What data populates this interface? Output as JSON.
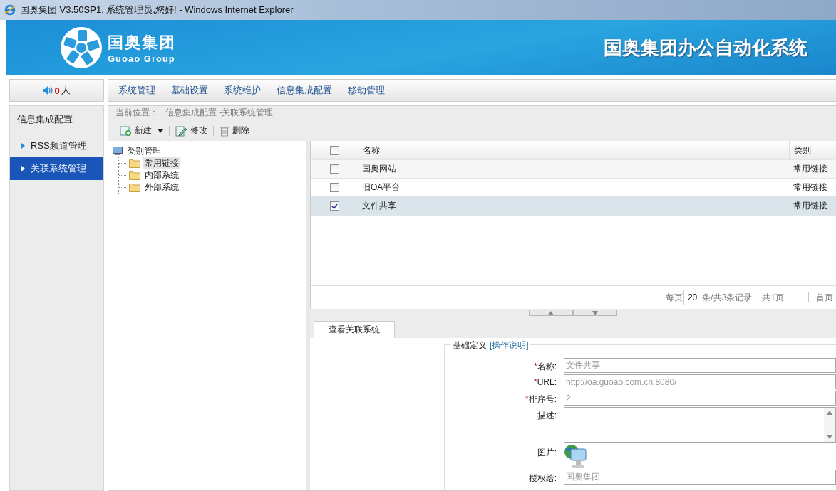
{
  "window": {
    "title": "国奥集团 V3.50SP1, 系统管理员,您好! - Windows Internet Explorer"
  },
  "banner": {
    "logo_cn": "国奥集团",
    "logo_en": "Guoao Group",
    "system_name": "国奥集团办公自动化系统"
  },
  "online": {
    "count": "0",
    "unit": "人"
  },
  "menu": [
    {
      "label": "系统管理"
    },
    {
      "label": "基础设置"
    },
    {
      "label": "系统维护"
    },
    {
      "label": "信息集成配置"
    },
    {
      "label": "移动管理"
    }
  ],
  "sidebar": {
    "title": "信息集成配置",
    "items": [
      {
        "label": "RSS频道管理",
        "selected": false
      },
      {
        "label": "关联系统管理",
        "selected": true
      }
    ]
  },
  "breadcrumb": {
    "label": "当前位置：",
    "path": "信息集成配置 -关联系统管理"
  },
  "toolbar": [
    {
      "kind": "new",
      "label": "新建"
    },
    {
      "kind": "edit",
      "label": "修改"
    },
    {
      "kind": "delete",
      "label": "删除"
    }
  ],
  "tree": {
    "label": "类别管理",
    "children": [
      {
        "label": "常用链接",
        "selected": true
      },
      {
        "label": "内部系统",
        "selected": false
      },
      {
        "label": "外部系统",
        "selected": false
      }
    ]
  },
  "table": {
    "columns": [
      "名称",
      "类别"
    ],
    "header_checked": false,
    "rows": [
      {
        "name": "国奥网站",
        "category": "常用链接",
        "checked": false,
        "selected": false
      },
      {
        "name": "旧OA平台",
        "category": "常用链接",
        "checked": false,
        "selected": false
      },
      {
        "name": "文件共享",
        "category": "常用链接",
        "checked": true,
        "selected": true
      }
    ]
  },
  "pager": {
    "per_page_label": "每页",
    "per_page": "20",
    "summary": "条/共3条记录",
    "pages": "共1页",
    "first": "首页"
  },
  "tabs": [
    {
      "label": "查看关联系统",
      "selected": true
    }
  ],
  "form": {
    "legend": "基础定义",
    "help_link": "[操作说明]",
    "fields": [
      {
        "kind": "text",
        "mark": "*",
        "label": "名称:",
        "value": "文件共享"
      },
      {
        "kind": "text",
        "mark": "*",
        "label": "URL:",
        "value": "http://oa.guoao.com.cn:8080/"
      },
      {
        "kind": "text",
        "mark": "*",
        "label": "排序号:",
        "value": "2"
      },
      {
        "kind": "textarea",
        "label": "描述:"
      },
      {
        "kind": "image",
        "label": "图片:"
      },
      {
        "kind": "text",
        "label": "授权给:",
        "value": "国奥集团"
      }
    ]
  }
}
